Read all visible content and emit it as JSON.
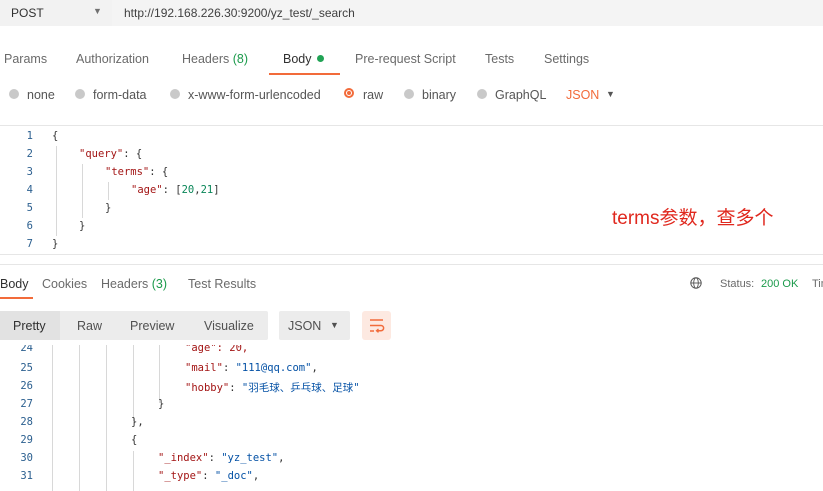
{
  "request": {
    "method": "POST",
    "url": "http://192.168.226.30:9200/yz_test/_search"
  },
  "request_tabs": {
    "params": "Params",
    "authorization": "Authorization",
    "headers": "Headers",
    "headers_count": "(8)",
    "body": "Body",
    "prerequest": "Pre-request Script",
    "tests": "Tests",
    "settings": "Settings"
  },
  "body_types": {
    "none": "none",
    "form_data": "form-data",
    "urlencoded": "x-www-form-urlencoded",
    "raw": "raw",
    "binary": "binary",
    "graphql": "GraphQL",
    "format": "JSON",
    "selected": "raw"
  },
  "editor": {
    "line_numbers": [
      "1",
      "2",
      "3",
      "4",
      "5",
      "6",
      "7"
    ],
    "line1": "{",
    "q_key": "\"query\"",
    "q_rest": ": {",
    "t_key": "\"terms\"",
    "t_rest": ": {",
    "a_key": "\"age\"",
    "a_colon": ": [",
    "a_v1": "20",
    "a_comma": ",",
    "a_v2": "21",
    "a_close": "]",
    "line5": "}",
    "line6": "}",
    "line7": "}"
  },
  "annotation": "terms参数，查多个",
  "response_tabs": {
    "body": "Body",
    "cookies": "Cookies",
    "headers": "Headers",
    "headers_count": "(3)",
    "test_results": "Test Results"
  },
  "status": {
    "label": "Status:",
    "value": "200 OK",
    "time_label": "Tim"
  },
  "view": {
    "pretty": "Pretty",
    "raw": "Raw",
    "preview": "Preview",
    "visualize": "Visualize",
    "format": "JSON"
  },
  "response": {
    "line_numbers": [
      "24",
      "25",
      "26",
      "27",
      "28",
      "29",
      "30",
      "31"
    ],
    "l24": "\"age\": 20,",
    "mail_key": "\"mail\"",
    "mail_val": "\"111@qq.com\"",
    "hobby_key": "\"hobby\"",
    "hobby_val": "\"羽毛球、乒乓球、足球\"",
    "l27": "}",
    "l28": "},",
    "l29": "{",
    "index_key": "\"_index\"",
    "index_val": "\"yz_test\"",
    "type_key": "\"_type\"",
    "type_val": "\"_doc\""
  },
  "colors": {
    "accent": "#f26b3a",
    "success": "#1b9a4b",
    "annotation": "#e0281e"
  }
}
